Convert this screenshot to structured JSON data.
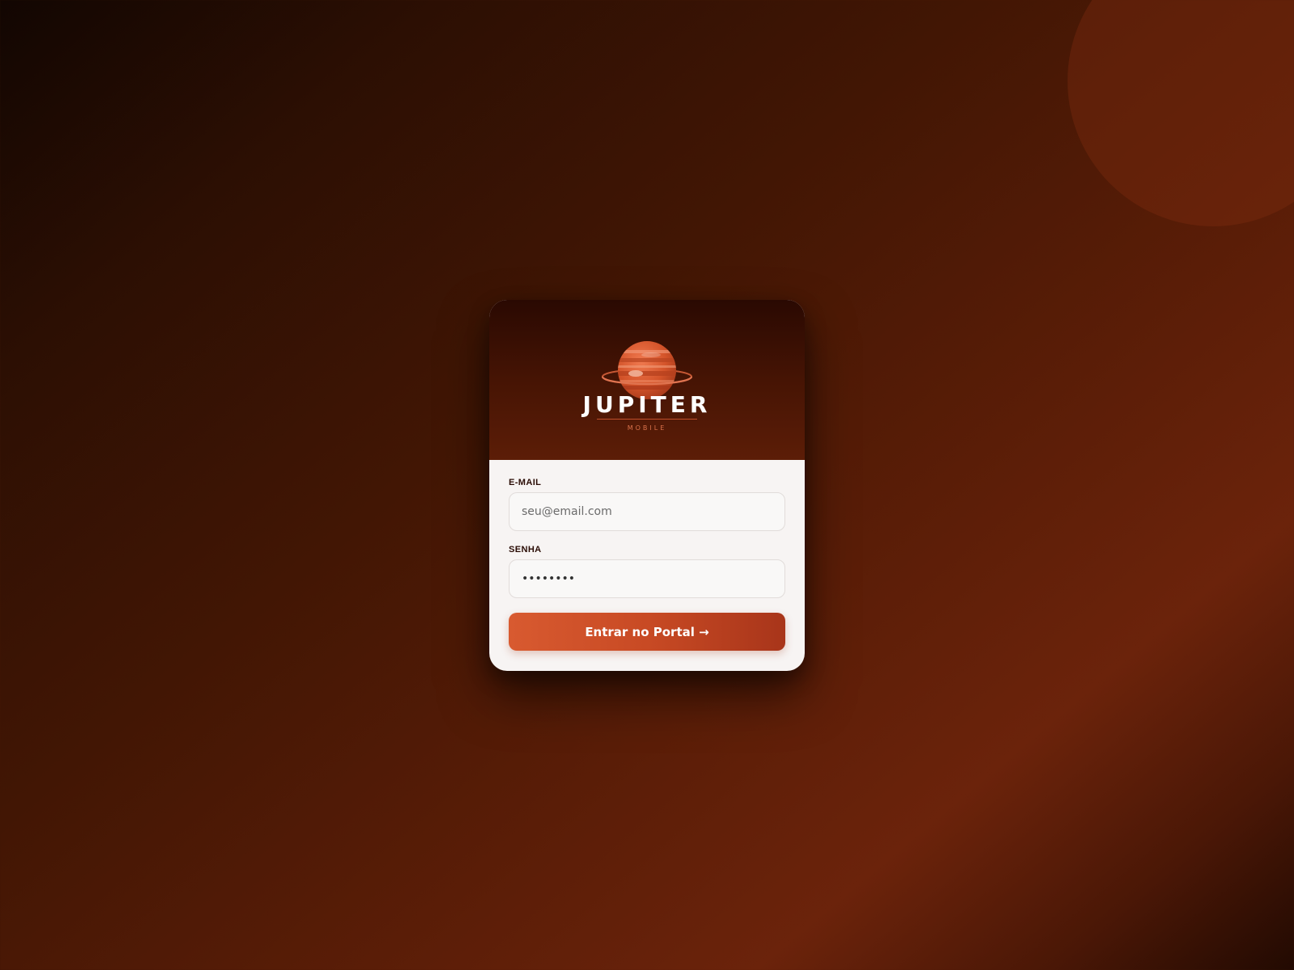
{
  "brand": {
    "name": "JUPITER",
    "subtitle": "MOBILE"
  },
  "form": {
    "email_label": "E-MAIL",
    "email_placeholder": "seu@email.com",
    "email_value": "",
    "password_label": "SENHA",
    "password_value": "••••••••",
    "submit_label": "Entrar no Portal →"
  },
  "colors": {
    "accent": "#d85a30",
    "accent_dark": "#a8351a",
    "header_dark": "#2a0902",
    "background_dark": "#120602",
    "background_warm": "#6b230b"
  },
  "icons": {
    "logo": "jupiter-planet-icon"
  }
}
